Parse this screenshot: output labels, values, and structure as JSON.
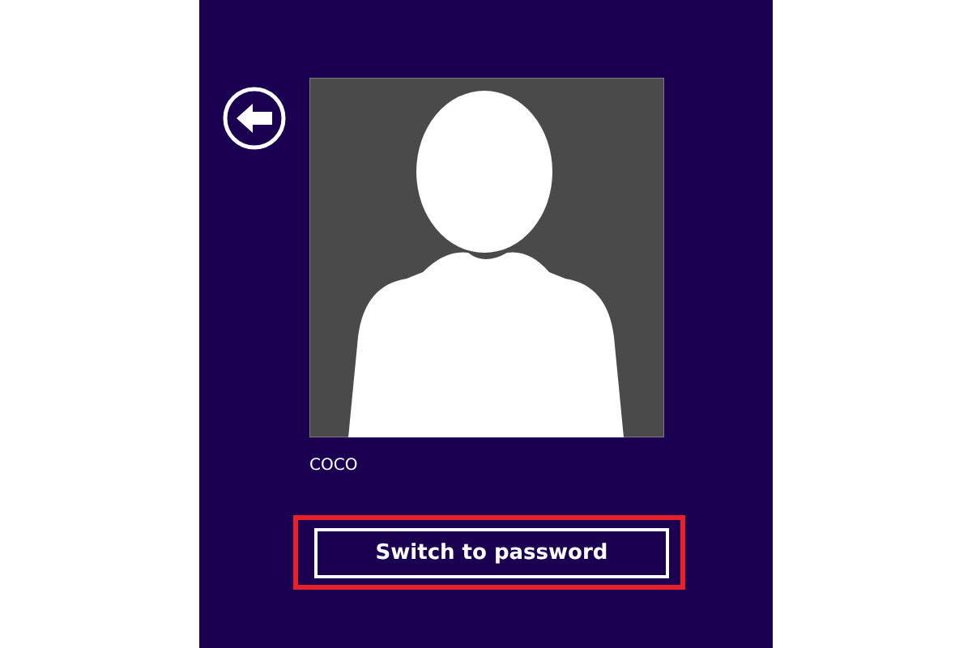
{
  "back_button": {
    "kind": "back"
  },
  "account": {
    "name": "COCO"
  },
  "switch_button": {
    "label": "Switch to password",
    "highlighted": true
  }
}
